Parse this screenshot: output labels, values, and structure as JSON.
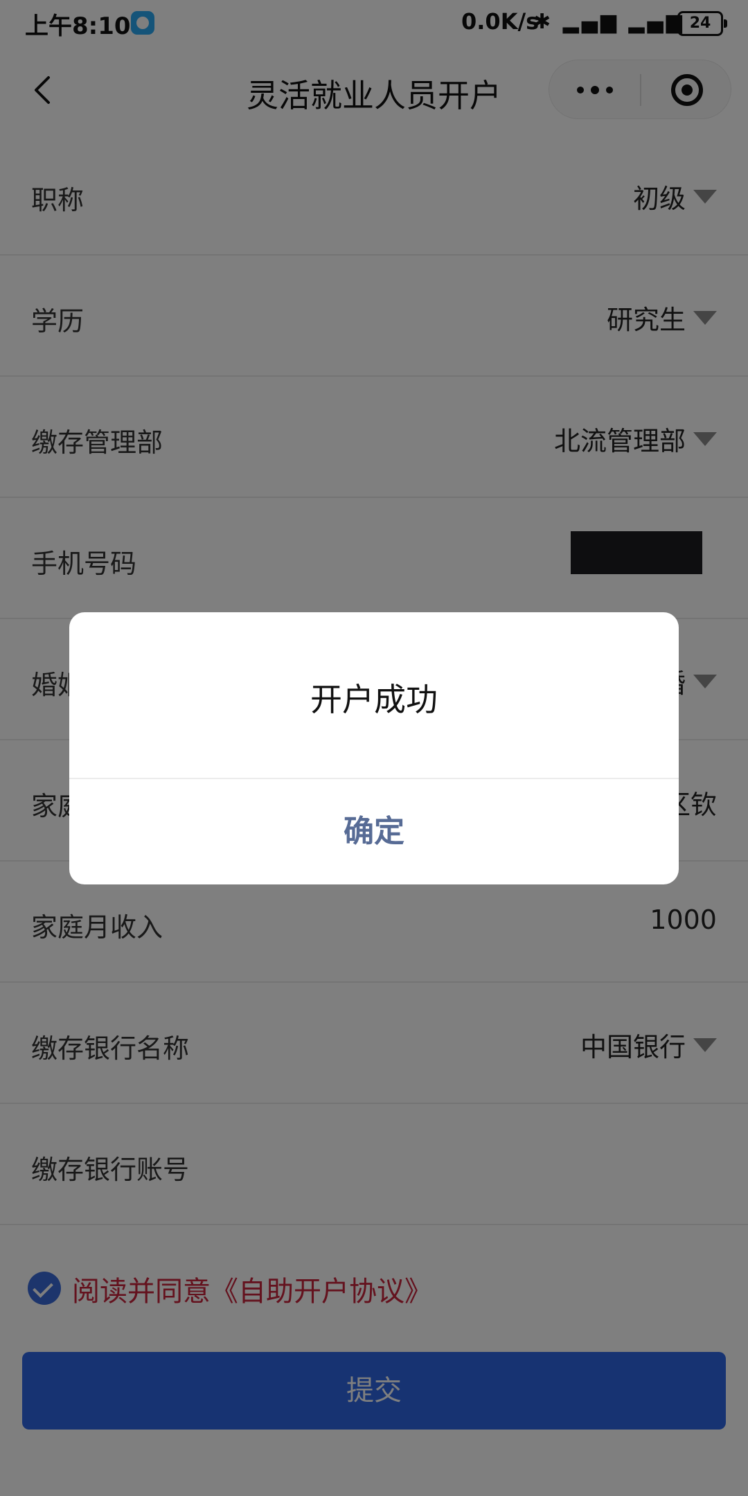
{
  "status_bar": {
    "time": "上午8:10",
    "speed": "0.0K/s",
    "icons": "✱ ▂▄▆ ▂▄▆",
    "battery": "24"
  },
  "nav": {
    "title": "灵活就业人员开户"
  },
  "form": {
    "rows": [
      {
        "label": "职称",
        "value": "初级"
      },
      {
        "label": "学历",
        "value": "研究生"
      },
      {
        "label": "缴存管理部",
        "value": "北流管理部"
      },
      {
        "label": "手机号码",
        "value": ""
      },
      {
        "label": "婚姻",
        "value": "婚"
      },
      {
        "label": "家庭",
        "value": "区钦"
      },
      {
        "label": "家庭月收入",
        "value": "1000"
      },
      {
        "label": "缴存银行名称",
        "value": "中国银行"
      },
      {
        "label": "缴存银行账号",
        "value": ""
      }
    ]
  },
  "agreement": {
    "text": "阅读并同意《自助开户协议》"
  },
  "submit_label": "提交",
  "dialog": {
    "title": "开户成功",
    "confirm_label": "确定"
  },
  "colors": {
    "primary": "#2e67e4",
    "agreement_text": "#c8243c",
    "dialog_confirm": "#576b95",
    "overlay": "rgba(0,0,0,0.5)"
  }
}
